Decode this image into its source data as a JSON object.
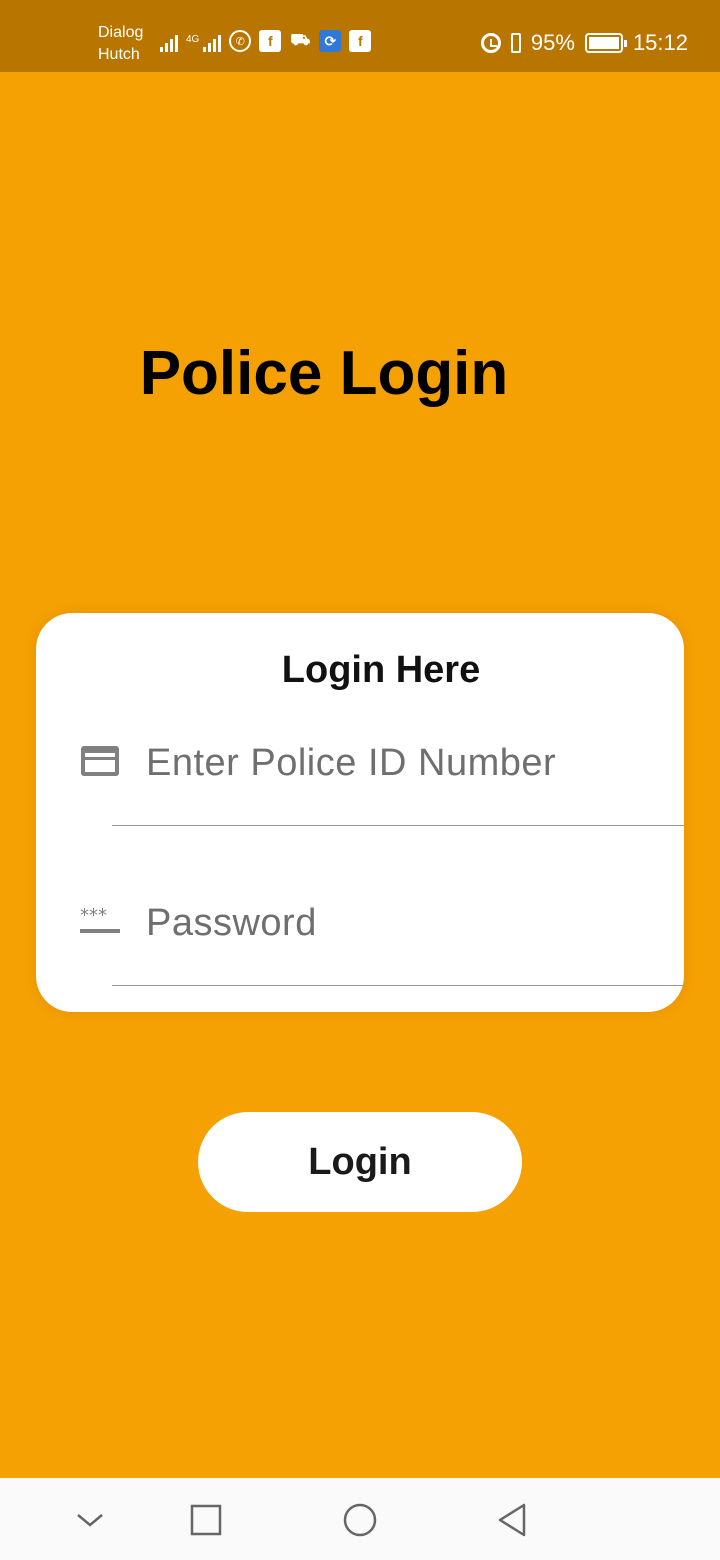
{
  "status_bar": {
    "carrier_1": "Dialog",
    "carrier_2": "Hutch",
    "network_tag": "4G",
    "battery_percent": "95%",
    "time": "15:12",
    "icons": [
      "signal-icon",
      "signal-4g-icon",
      "whatsapp-icon",
      "facebook-icon",
      "car-icon",
      "sync-app-icon",
      "facebook-icon",
      "alarm-icon",
      "vibrate-icon",
      "battery-charging-icon"
    ]
  },
  "page": {
    "title": "Police Login"
  },
  "login_card": {
    "heading": "Login Here",
    "id_field": {
      "placeholder": "Enter Police ID Number",
      "value": "",
      "icon": "card-icon"
    },
    "password_field": {
      "placeholder": "Password",
      "value": "",
      "icon": "password-icon"
    }
  },
  "login_button": {
    "label": "Login"
  },
  "navigation_bar": {
    "items": [
      "collapse-icon",
      "recent-apps-icon",
      "home-icon",
      "back-icon"
    ]
  },
  "colors": {
    "background": "#F5A003",
    "status_bar": "#B87600",
    "card": "#FFFFFF",
    "button": "#FFFFFF"
  }
}
